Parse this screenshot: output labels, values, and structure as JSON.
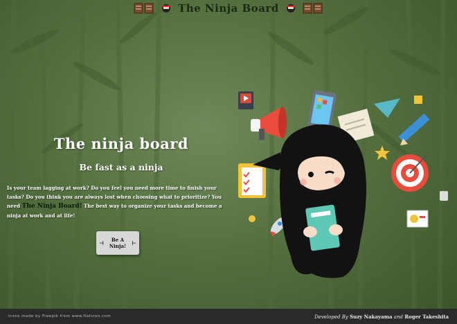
{
  "header": {
    "title": "The Ninja Board"
  },
  "hero": {
    "title": "The ninja board",
    "subtitle": "Be fast as a ninja",
    "body_before": "Is your team lagging at work? Do you feel you need more time to finish your tasks? Do you think you are always lost when choosing what to prioritize? You need ",
    "body_emphasis": "The Ninja Board!",
    "body_after": " The best way to organize your tasks and become a ninja at work and at life!"
  },
  "cta": {
    "label": "Be A Ninja!"
  },
  "footer": {
    "credit_left": "Icons made by Freepik from www.flaticon.com",
    "dev_prefix": "Developed By",
    "dev_name1": "Suzy Nakayama",
    "dev_and": "and",
    "dev_name2": "Roger Takeshita"
  },
  "colors": {
    "title": "#1b2814",
    "footer_bg": "#2a2a2a",
    "button_bg": "#d8d8d8"
  }
}
